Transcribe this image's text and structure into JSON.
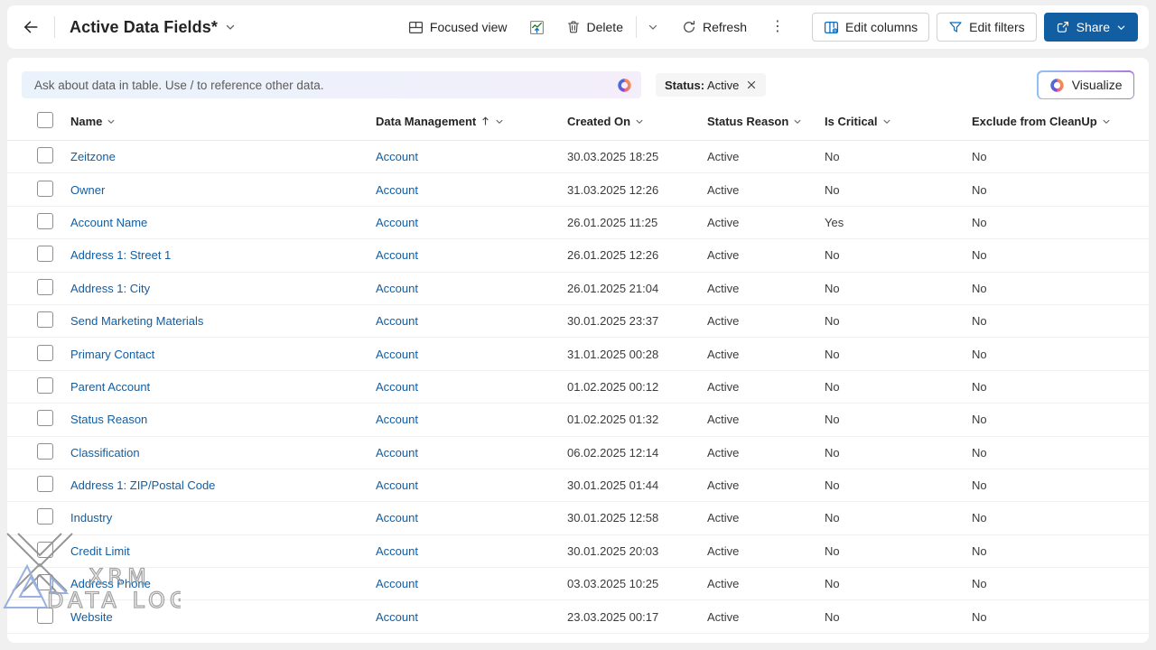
{
  "topbar": {
    "title": "Active Data Fields*",
    "focused_view_label": "Focused view",
    "delete_label": "Delete",
    "refresh_label": "Refresh",
    "edit_columns_label": "Edit columns",
    "edit_filters_label": "Edit filters",
    "share_label": "Share"
  },
  "copilot_bar": {
    "placeholder": "Ask about data in table. Use / to reference other data.",
    "filter_chip_label": "Status:",
    "filter_chip_value": "Active",
    "visualize_label": "Visualize"
  },
  "table": {
    "columns": [
      {
        "label": "Name"
      },
      {
        "label": "Data Management",
        "sort_direction": "ascending"
      },
      {
        "label": "Created On"
      },
      {
        "label": "Status Reason"
      },
      {
        "label": "Is Critical"
      },
      {
        "label": "Exclude from CleanUp"
      }
    ],
    "rows": [
      {
        "name": "Zeitzone",
        "data_management": "Account",
        "created_on": "30.03.2025 18:25",
        "status_reason": "Active",
        "is_critical": "No",
        "exclude_from_cleanup": "No"
      },
      {
        "name": "Owner",
        "data_management": "Account",
        "created_on": "31.03.2025 12:26",
        "status_reason": "Active",
        "is_critical": "No",
        "exclude_from_cleanup": "No"
      },
      {
        "name": "Account Name",
        "data_management": "Account",
        "created_on": "26.01.2025 11:25",
        "status_reason": "Active",
        "is_critical": "Yes",
        "exclude_from_cleanup": "No"
      },
      {
        "name": "Address 1: Street 1",
        "data_management": "Account",
        "created_on": "26.01.2025 12:26",
        "status_reason": "Active",
        "is_critical": "No",
        "exclude_from_cleanup": "No"
      },
      {
        "name": "Address 1: City",
        "data_management": "Account",
        "created_on": "26.01.2025 21:04",
        "status_reason": "Active",
        "is_critical": "No",
        "exclude_from_cleanup": "No"
      },
      {
        "name": "Send Marketing Materials",
        "data_management": "Account",
        "created_on": "30.01.2025 23:37",
        "status_reason": "Active",
        "is_critical": "No",
        "exclude_from_cleanup": "No"
      },
      {
        "name": "Primary Contact",
        "data_management": "Account",
        "created_on": "31.01.2025 00:28",
        "status_reason": "Active",
        "is_critical": "No",
        "exclude_from_cleanup": "No"
      },
      {
        "name": "Parent Account",
        "data_management": "Account",
        "created_on": "01.02.2025 00:12",
        "status_reason": "Active",
        "is_critical": "No",
        "exclude_from_cleanup": "No"
      },
      {
        "name": "Status Reason",
        "data_management": "Account",
        "created_on": "01.02.2025 01:32",
        "status_reason": "Active",
        "is_critical": "No",
        "exclude_from_cleanup": "No"
      },
      {
        "name": "Classification",
        "data_management": "Account",
        "created_on": "06.02.2025 12:14",
        "status_reason": "Active",
        "is_critical": "No",
        "exclude_from_cleanup": "No"
      },
      {
        "name": "Address 1: ZIP/Postal Code",
        "data_management": "Account",
        "created_on": "30.01.2025 01:44",
        "status_reason": "Active",
        "is_critical": "No",
        "exclude_from_cleanup": "No"
      },
      {
        "name": "Industry",
        "data_management": "Account",
        "created_on": "30.01.2025 12:58",
        "status_reason": "Active",
        "is_critical": "No",
        "exclude_from_cleanup": "No"
      },
      {
        "name": "Credit Limit",
        "data_management": "Account",
        "created_on": "30.01.2025 20:03",
        "status_reason": "Active",
        "is_critical": "No",
        "exclude_from_cleanup": "No"
      },
      {
        "name": "Address Phone",
        "data_management": "Account",
        "created_on": "03.03.2025 10:25",
        "status_reason": "Active",
        "is_critical": "No",
        "exclude_from_cleanup": "No"
      },
      {
        "name": "Website",
        "data_management": "Account",
        "created_on": "23.03.2025 00:17",
        "status_reason": "Active",
        "is_critical": "No",
        "exclude_from_cleanup": "No"
      }
    ]
  },
  "watermark": {
    "line1": "XRM",
    "line2": "DATA LOG"
  },
  "colors": {
    "link_blue": "#115ea3",
    "share_blue": "#115ea3",
    "icon_blue": "#0f6cbd",
    "chart_green": "#107c10"
  }
}
